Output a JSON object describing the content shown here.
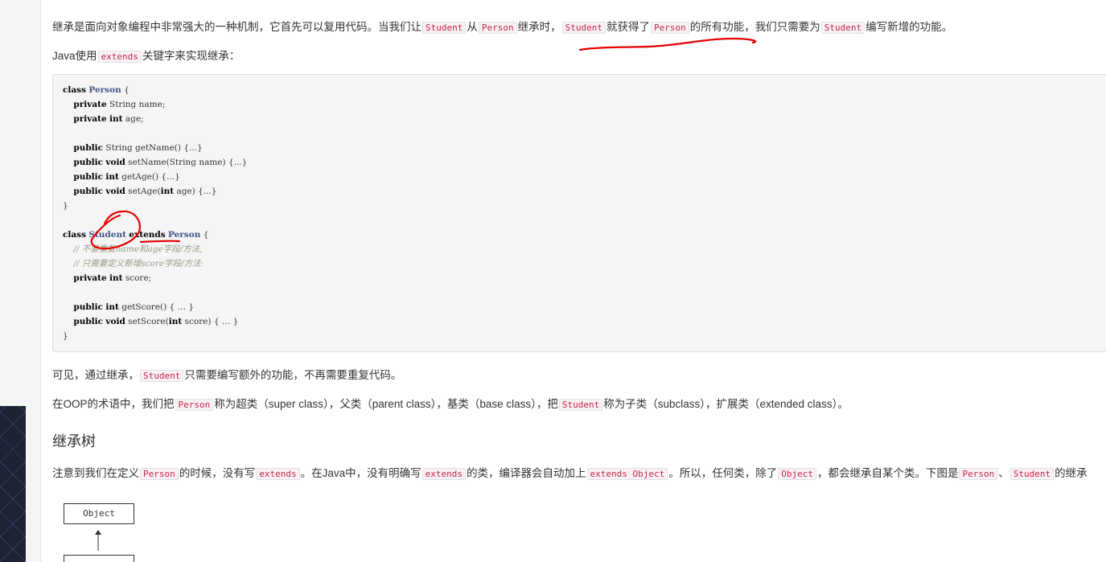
{
  "intro": {
    "p1": [
      "继承是面向对象编程中非常强大的一种机制，它首先可以复用代码。当我们让",
      "Student",
      "从",
      "Person",
      "继承时，",
      "Student",
      "就获得了",
      "Person",
      "的所有功能，我们只需要为",
      "Student",
      "编写新增的功能。"
    ],
    "p2": [
      "Java使用",
      "extends",
      "关键字来实现继承："
    ]
  },
  "code_block": {
    "lines": [
      [
        [
          "kw",
          "class"
        ],
        [
          "t",
          " "
        ],
        [
          "ty",
          "Person"
        ],
        [
          "t",
          " {"
        ]
      ],
      [
        [
          "t",
          "    "
        ],
        [
          "kw",
          "private"
        ],
        [
          "t",
          " String name;"
        ]
      ],
      [
        [
          "t",
          "    "
        ],
        [
          "kw",
          "private"
        ],
        [
          "t",
          " "
        ],
        [
          "kw",
          "int"
        ],
        [
          "t",
          " age;"
        ]
      ],
      [],
      [
        [
          "t",
          "    "
        ],
        [
          "kw",
          "public"
        ],
        [
          "t",
          " String getName() {...}"
        ]
      ],
      [
        [
          "t",
          "    "
        ],
        [
          "kw",
          "public"
        ],
        [
          "t",
          " "
        ],
        [
          "kw",
          "void"
        ],
        [
          "t",
          " setName(String name) {...}"
        ]
      ],
      [
        [
          "t",
          "    "
        ],
        [
          "kw",
          "public"
        ],
        [
          "t",
          " "
        ],
        [
          "kw",
          "int"
        ],
        [
          "t",
          " getAge() {...}"
        ]
      ],
      [
        [
          "t",
          "    "
        ],
        [
          "kw",
          "public"
        ],
        [
          "t",
          " "
        ],
        [
          "kw",
          "void"
        ],
        [
          "t",
          " setAge("
        ],
        [
          "kw",
          "int"
        ],
        [
          "t",
          " age) {...}"
        ]
      ],
      [
        [
          "t",
          "}"
        ]
      ],
      [],
      [
        [
          "kw",
          "class"
        ],
        [
          "t",
          " "
        ],
        [
          "ty",
          "Student"
        ],
        [
          "t",
          " "
        ],
        [
          "kw",
          "extends"
        ],
        [
          "t",
          " "
        ],
        [
          "ty",
          "Person"
        ],
        [
          "t",
          " {"
        ]
      ],
      [
        [
          "t",
          "    "
        ],
        [
          "cm",
          "// 不要重复name和age字段/方法,"
        ]
      ],
      [
        [
          "t",
          "    "
        ],
        [
          "cm",
          "// 只需要定义新增score字段/方法:"
        ]
      ],
      [
        [
          "t",
          "    "
        ],
        [
          "kw",
          "private"
        ],
        [
          "t",
          " "
        ],
        [
          "kw",
          "int"
        ],
        [
          "t",
          " score;"
        ]
      ],
      [],
      [
        [
          "t",
          "    "
        ],
        [
          "kw",
          "public"
        ],
        [
          "t",
          " "
        ],
        [
          "kw",
          "int"
        ],
        [
          "t",
          " getScore() { … }"
        ]
      ],
      [
        [
          "t",
          "    "
        ],
        [
          "kw",
          "public"
        ],
        [
          "t",
          " "
        ],
        [
          "kw",
          "void"
        ],
        [
          "t",
          " setScore("
        ],
        [
          "kw",
          "int"
        ],
        [
          "t",
          " score) { … }"
        ]
      ],
      [
        [
          "t",
          "}"
        ]
      ]
    ]
  },
  "after": {
    "p3": [
      "可见，通过继承，",
      "Student",
      "只需要编写额外的功能，不再需要重复代码。"
    ],
    "p4": [
      "在OOP的术语中，我们把",
      "Person",
      "称为超类（super class），父类（parent class），基类（base class），把",
      "Student",
      "称为子类（subclass），扩展类（extended class）。"
    ]
  },
  "section": {
    "title": "继承树",
    "p5": [
      "注意到我们在定义",
      "Person",
      "的时候，没有写",
      "extends",
      "。在Java中，没有明确写",
      "extends",
      "的类，编译器会自动加上",
      "extends Object",
      "。所以，任何类，除了",
      "Object",
      "，都会继承自某个类。下图是",
      "Person",
      "、",
      "Student",
      "的继承"
    ]
  },
  "diagram": {
    "top_box": "Object",
    "bottom_box": ""
  },
  "colors": {
    "inline_code": "#c7254e",
    "annotation": "#e60000",
    "annotation_blue": "#1a3cc8"
  }
}
